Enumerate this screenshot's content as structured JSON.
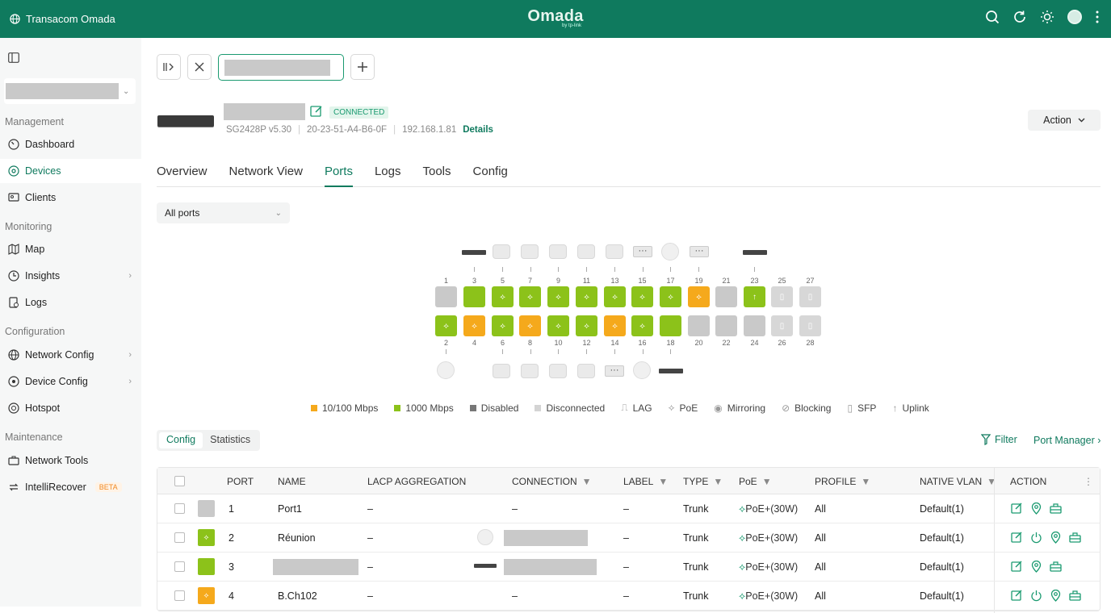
{
  "topbar": {
    "brand": "Transacom Omada",
    "logo": "Omada",
    "logo_sub": "by tp-link"
  },
  "sidebar": {
    "sections": {
      "management": "Management",
      "monitoring": "Monitoring",
      "configuration": "Configuration",
      "maintenance": "Maintenance"
    },
    "items": [
      {
        "label": "Dashboard",
        "icon": "dashboard-icon"
      },
      {
        "label": "Devices",
        "icon": "devices-icon",
        "active": true
      },
      {
        "label": "Clients",
        "icon": "clients-icon"
      },
      {
        "label": "Map",
        "icon": "map-icon"
      },
      {
        "label": "Insights",
        "icon": "insights-icon"
      },
      {
        "label": "Logs",
        "icon": "logs-icon"
      },
      {
        "label": "Network Config",
        "icon": "globe-icon"
      },
      {
        "label": "Device Config",
        "icon": "device-config-icon"
      },
      {
        "label": "Hotspot",
        "icon": "hotspot-icon"
      },
      {
        "label": "Network Tools",
        "icon": "toolbox-icon"
      },
      {
        "label": "IntelliRecover",
        "icon": "recover-icon",
        "badge": "BETA"
      }
    ]
  },
  "device": {
    "status": "CONNECTED",
    "model": "SG2428P v5.30",
    "mac": "20-23-51-A4-B6-0F",
    "ip": "192.168.1.81",
    "details_link": "Details",
    "action_label": "Action"
  },
  "tabs": [
    "Overview",
    "Network View",
    "Ports",
    "Logs",
    "Tools",
    "Config"
  ],
  "port_filter": "All ports",
  "port_labels_top": [
    "1",
    "3",
    "5",
    "7",
    "9",
    "11",
    "13",
    "15",
    "17",
    "19",
    "21",
    "23",
    "25",
    "27"
  ],
  "port_labels_bottom": [
    "2",
    "4",
    "6",
    "8",
    "10",
    "12",
    "14",
    "16",
    "18",
    "20",
    "22",
    "24",
    "26",
    "28"
  ],
  "legend": [
    "10/100 Mbps",
    "1000 Mbps",
    "Disabled",
    "Disconnected",
    "LAG",
    "PoE",
    "Mirroring",
    "Blocking",
    "SFP",
    "Uplink"
  ],
  "colors": {
    "green": "#8cc21a",
    "orange": "#f5a91c",
    "gray": "#c9c9c9",
    "brand": "#0f7a5e"
  },
  "subtabs": [
    "Config",
    "Statistics"
  ],
  "filter_label": "Filter",
  "port_manager_label": "Port Manager ›",
  "table": {
    "headers": [
      "PORT",
      "NAME",
      "LACP AGGREGATION",
      "CONNECTION",
      "LABEL",
      "TYPE",
      "PoE",
      "PROFILE",
      "NATIVE VLAN",
      "ACTION"
    ],
    "rows": [
      {
        "port": "1",
        "name": "Port1",
        "lacp": "–",
        "connection": "–",
        "label": "–",
        "type": "Trunk",
        "poe": "PoE+(30W)",
        "profile": "All",
        "vlan": "Default(1)"
      },
      {
        "port": "2",
        "name": "Réunion",
        "lacp": "–",
        "connection": "",
        "label": "–",
        "type": "Trunk",
        "poe": "PoE+(30W)",
        "profile": "All",
        "vlan": "Default(1)"
      },
      {
        "port": "3",
        "name": "",
        "lacp": "–",
        "connection": "",
        "label": "–",
        "type": "Trunk",
        "poe": "PoE+(30W)",
        "profile": "All",
        "vlan": "Default(1)"
      },
      {
        "port": "4",
        "name": "B.Ch102",
        "lacp": "–",
        "connection": "–",
        "label": "–",
        "type": "Trunk",
        "poe": "PoE+(30W)",
        "profile": "All",
        "vlan": "Default(1)"
      }
    ]
  }
}
